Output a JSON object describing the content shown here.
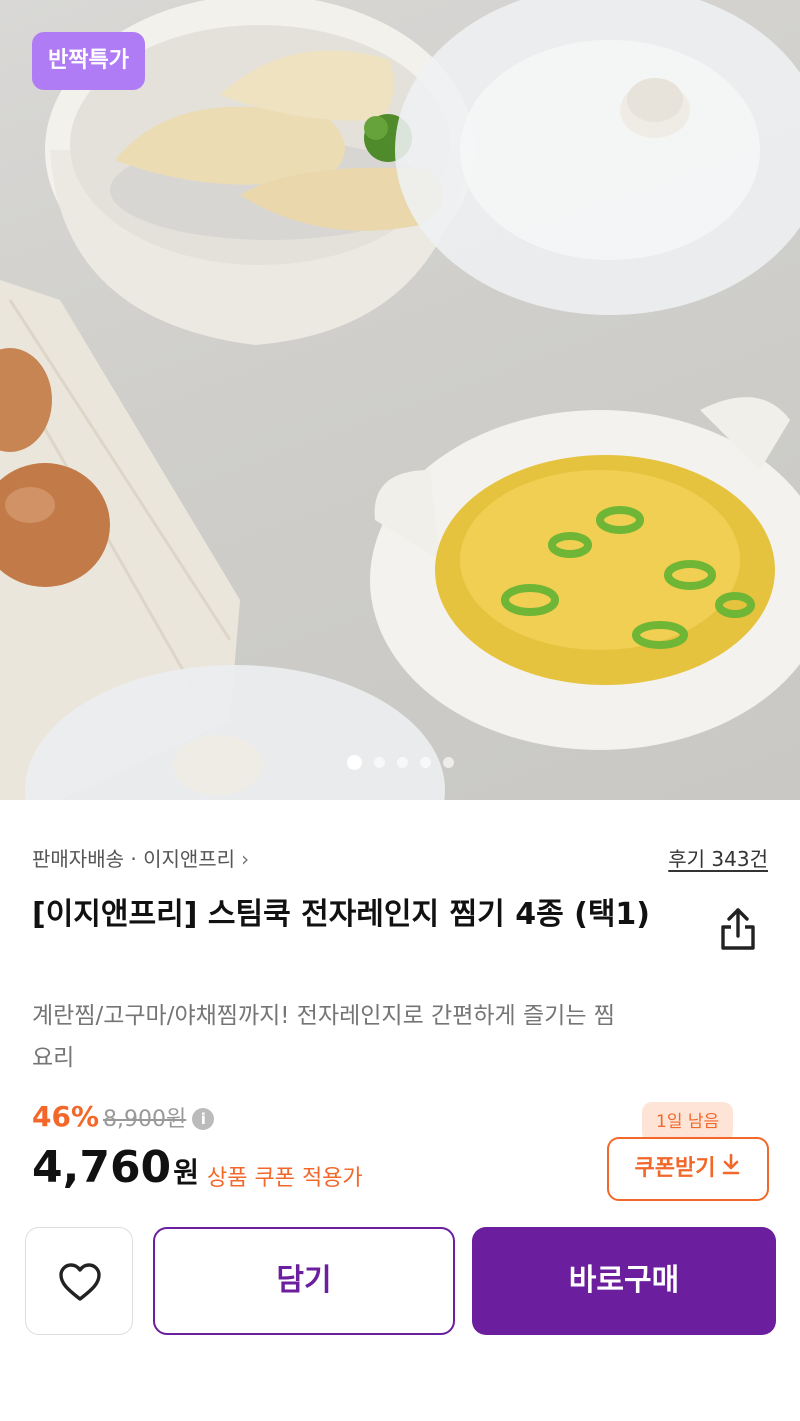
{
  "hero": {
    "badge": "반짝특가",
    "slide_count": 5,
    "active_slide": 0
  },
  "product": {
    "seller_line": "판매자배송 · 이지앤프리",
    "review_link": "후기 343건",
    "title": "[이지앤프리] 스팀쿡 전자레인지 찜기 4종 (택1)",
    "subtitle": "계란찜/고구마/야채찜까지! 전자레인지로 간편하게 즐기는 찜요리"
  },
  "pricing": {
    "discount": "46%",
    "original_price": "8,900원",
    "info_symbol": "i",
    "price": "4,760",
    "currency": "원",
    "coupon_note": "상품 쿠폰 적용가",
    "days_left": "1일 남음",
    "coupon_button": "쿠폰받기",
    "accent_color": "#f2682a"
  },
  "actions": {
    "cart": "담기",
    "buy_now": "바로구매",
    "brand_color": "#6b1f9e"
  },
  "icons": {
    "share": "share-icon",
    "heart": "heart-icon",
    "download": "download-arrow-icon",
    "chevron": "chevron-right-icon"
  }
}
